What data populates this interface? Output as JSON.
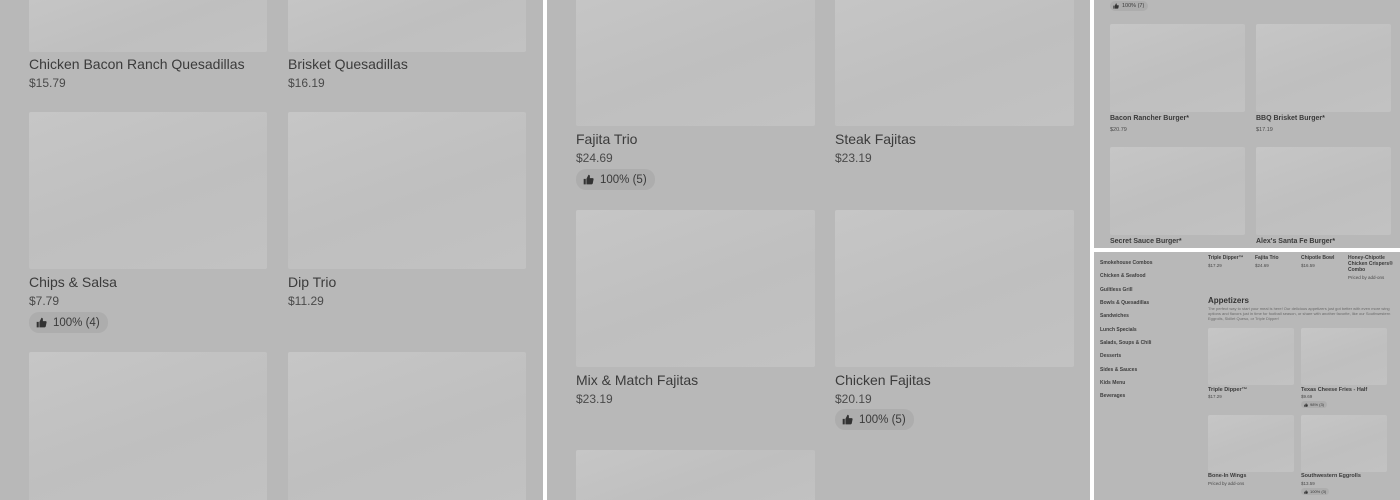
{
  "panel1": {
    "items": [
      {
        "name": "Chicken Bacon Ranch Quesadillas",
        "price": "$15.79"
      },
      {
        "name": "Brisket Quesadillas",
        "price": "$16.19"
      },
      {
        "name": "Chips & Salsa",
        "price": "$7.79",
        "rating": "100% (4)"
      },
      {
        "name": "Dip Trio",
        "price": "$11.29"
      }
    ]
  },
  "panel2": {
    "items": [
      {
        "name": "Fajita Trio",
        "price": "$24.69",
        "rating": "100% (5)"
      },
      {
        "name": "Steak Fajitas",
        "price": "$23.19"
      },
      {
        "name": "Mix & Match Fajitas",
        "price": "$23.19"
      },
      {
        "name": "Chicken Fajitas",
        "price": "$20.19",
        "rating": "100% (5)"
      }
    ]
  },
  "panel3": {
    "top_rating": "100% (7)",
    "items": [
      {
        "name": "Bacon Rancher Burger*",
        "price": "$20.79"
      },
      {
        "name": "BBQ Brisket Burger*",
        "price": "$17.19"
      },
      {
        "name": "Secret Sauce Burger*"
      },
      {
        "name": "Alex's Santa Fe Burger*"
      }
    ]
  },
  "panel4": {
    "sidebar": [
      "Smokehouse Combos",
      "Chicken & Seafood",
      "Guiltless Grill",
      "Bowls & Quesadillas",
      "Sandwiches",
      "Lunch Specials",
      "Salads, Soups & Chili",
      "Desserts",
      "Sides & Sauces",
      "Kids Menu",
      "Beverages"
    ],
    "top_row": [
      {
        "name": "Triple Dipper™",
        "price": "$17.29"
      },
      {
        "name": "Fajita Trio",
        "price": "$24.69"
      },
      {
        "name": "Chipotle Bowl",
        "price": "$16.59"
      },
      {
        "name": "Honey-Chipotle Chicken Crispers® Combo",
        "price": "Priced by add-ons"
      }
    ],
    "section_title": "Appetizers",
    "section_desc": "The perfect way to start your meal is here! Our delicious appetizers just got better with even more wing options and flavors just in time for football season, or share with another favorite, like our Southwestern Eggrolls, Skillet Queso, or Triple Dipper!",
    "items": [
      {
        "name": "Triple Dipper™",
        "price": "$17.29"
      },
      {
        "name": "Texas Cheese Fries - Half",
        "price": "$9.69",
        "rating": "98% (3)"
      },
      {
        "name": "Bone-In Wings",
        "price": "Priced by add-ons"
      },
      {
        "name": "Southwestern Eggrolls",
        "price": "$13.59",
        "rating": "100% (3)"
      }
    ]
  },
  "icons": {
    "rating": "thumbs-up-icon"
  },
  "colors": {
    "overlay": "#b8b8b8",
    "image_placeholder": "#c4c4c4",
    "badge": "#adadad"
  }
}
